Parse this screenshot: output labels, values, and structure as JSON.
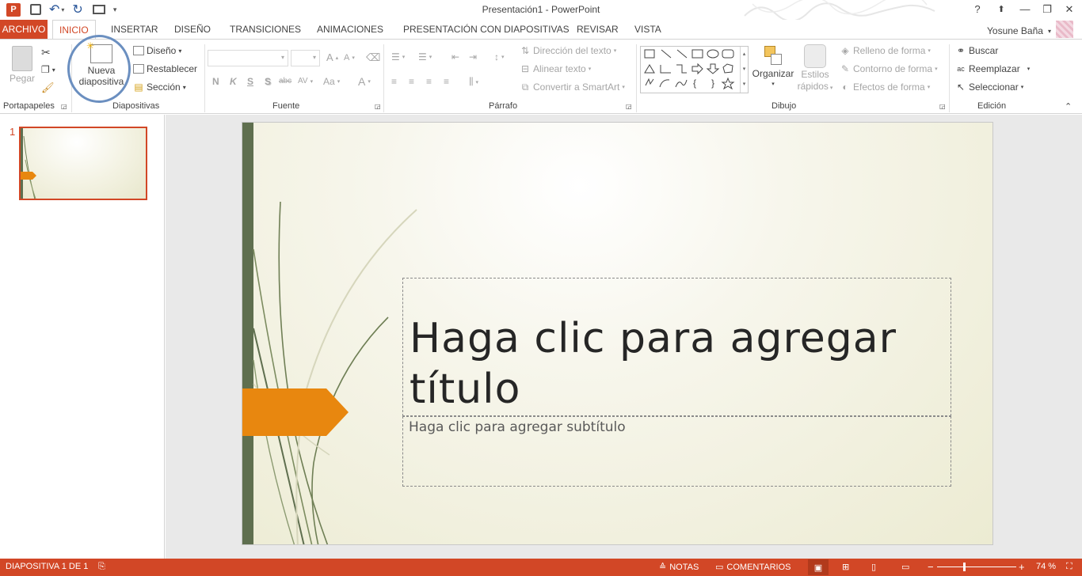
{
  "app": {
    "window_title": "Presentación1 - PowerPoint",
    "user_name": "Yosune Baña"
  },
  "quick_access": {
    "icons": [
      "powerpoint-logo-icon",
      "save-icon",
      "undo-icon",
      "redo-icon",
      "start-presentation-icon",
      "customize-icon"
    ]
  },
  "window_controls": {
    "help": "?",
    "ribbon_options": "⬆",
    "minimize": "—",
    "restore": "❐",
    "close": "✕"
  },
  "tabs": [
    {
      "label": "ARCHIVO"
    },
    {
      "label": "INICIO"
    },
    {
      "label": "INSERTAR"
    },
    {
      "label": "DISEÑO"
    },
    {
      "label": "TRANSICIONES"
    },
    {
      "label": "ANIMACIONES"
    },
    {
      "label": "PRESENTACIÓN CON DIAPOSITIVAS"
    },
    {
      "label": "REVISAR"
    },
    {
      "label": "VISTA"
    }
  ],
  "ribbon": {
    "clipboard": {
      "paste": "Pegar",
      "group": "Portapapeles"
    },
    "slides": {
      "new_slide_line1": "Nueva",
      "new_slide_line2": "diapositiva",
      "layout": "Diseño",
      "reset": "Restablecer",
      "section": "Sección",
      "group": "Diapositivas"
    },
    "font": {
      "bold": "N",
      "italic": "K",
      "underline": "S",
      "shadow": "S",
      "strike": "abc",
      "spacing": "AV",
      "case": "Aa",
      "color": "A",
      "grow": "A",
      "shrink": "A",
      "group": "Fuente"
    },
    "paragraph": {
      "text_direction": "Dirección del texto",
      "align_text": "Alinear texto",
      "smartart": "Convertir a SmartArt",
      "group": "Párrafo"
    },
    "drawing": {
      "arrange": "Organizar",
      "quick_styles_1": "Estilos",
      "quick_styles_2": "rápidos",
      "shape_fill": "Relleno de forma",
      "shape_outline": "Contorno de forma",
      "shape_effects": "Efectos de forma",
      "group": "Dibujo"
    },
    "editing": {
      "find": "Buscar",
      "replace": "Reemplazar",
      "select": "Seleccionar",
      "group": "Edición"
    }
  },
  "thumbnails": [
    {
      "number": "1"
    }
  ],
  "slide": {
    "title_line1": "Haga clic para agregar",
    "title_line2": "título",
    "subtitle": "Haga clic para agregar subtítulo"
  },
  "statusbar": {
    "slide_info": "DIAPOSITIVA 1 DE 1",
    "notes": "NOTAS",
    "comments": "COMENTARIOS",
    "zoom": "74 %",
    "zoom_out": "−",
    "zoom_in": "+"
  },
  "colors": {
    "accent": "#d24726",
    "slide_orange": "#e8870f",
    "slide_green": "#5f6f4f"
  }
}
